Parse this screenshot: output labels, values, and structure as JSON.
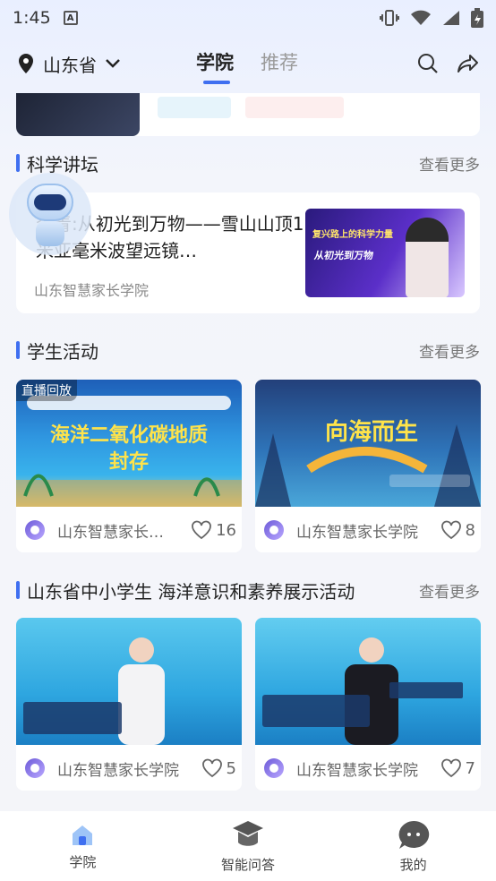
{
  "status_bar": {
    "time": "1:45",
    "sim_label": "A"
  },
  "top_nav": {
    "location": "山东省",
    "tabs": [
      {
        "label": "学院",
        "active": true
      },
      {
        "label": "推荐",
        "active": false
      }
    ],
    "accent_color": "#3f6ff0"
  },
  "sections": {
    "science": {
      "title": "科学讲坛",
      "more": "查看更多",
      "lecture": {
        "title": "李青:从初光到万物——雪山山顶1米亚毫米波望远镜…",
        "source": "山东智慧家长学院",
        "thumb_text_1": "复兴路上的科学力量",
        "thumb_text_2": "从初光到万物"
      }
    },
    "activities": {
      "title": "学生活动",
      "more": "查看更多",
      "items": [
        {
          "badge": "直播回放",
          "thumb_title": "海洋二氧化碳地质封存",
          "source": "山东智慧家长…",
          "likes": "16"
        },
        {
          "badge": "",
          "thumb_title": "向海而生",
          "source": "山东智慧家长学院",
          "likes": "8"
        }
      ]
    },
    "ocean": {
      "title": "山东省中小学生 海洋意识和素养展示活动",
      "more": "查看更多",
      "items": [
        {
          "source": "山东智慧家长学院",
          "likes": "5"
        },
        {
          "source": "山东智慧家长学院",
          "likes": "7"
        }
      ]
    }
  },
  "bottom_tabs": [
    {
      "label": "学院",
      "icon": "home-icon",
      "active": true
    },
    {
      "label": "智能问答",
      "icon": "graduation-cap-icon",
      "active": false
    },
    {
      "label": "我的",
      "icon": "chat-face-icon",
      "active": false
    }
  ]
}
